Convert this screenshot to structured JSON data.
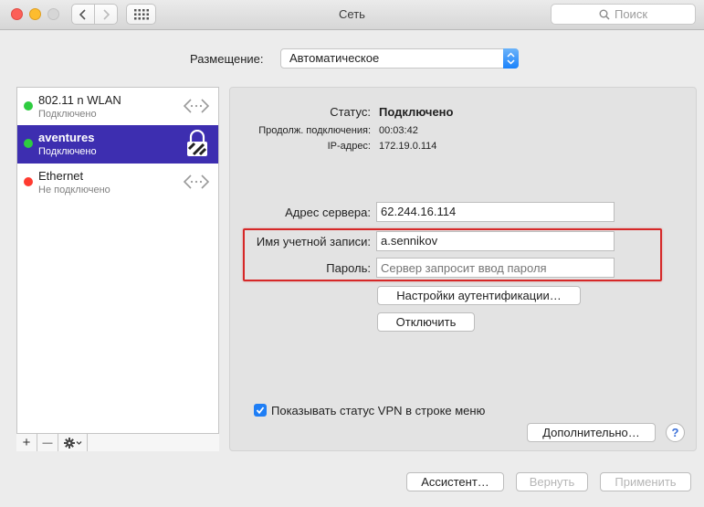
{
  "window": {
    "title": "Сеть",
    "search_placeholder": "Поиск"
  },
  "location": {
    "label": "Размещение:",
    "value": "Автоматическое"
  },
  "services": [
    {
      "name": "802.11 n WLAN",
      "status": "Подключено",
      "status_color": "#2ecc40",
      "icon": "network-arrows-icon"
    },
    {
      "name": "aventures",
      "status": "Подключено",
      "status_color": "#2ecc40",
      "icon": "vpn-lock-icon",
      "selected": true
    },
    {
      "name": "Ethernet",
      "status": "Не подключено",
      "status_color": "#ff3b30",
      "icon": "network-arrows-icon"
    }
  ],
  "sidebar_buttons": {
    "add": "+",
    "remove": "—",
    "action": "gear-icon"
  },
  "details": {
    "status_label": "Статус:",
    "status_value": "Подключено",
    "duration_label": "Продолж. подключения:",
    "duration_value": "00:03:42",
    "ip_label": "IP-адрес:",
    "ip_value": "172.19.0.114"
  },
  "form": {
    "server_label": "Адрес сервера:",
    "server_value": "62.244.16.114",
    "account_label": "Имя учетной записи:",
    "account_value": "a.sennikov",
    "password_label": "Пароль:",
    "password_placeholder": "Сервер запросит ввод пароля",
    "auth_button": "Настройки аутентификации…",
    "disconnect_button": "Отключить"
  },
  "show_vpn_status": {
    "label": "Показывать статус VPN в строке меню",
    "checked": true
  },
  "advanced_button": "Дополнительно…",
  "help_button": "?",
  "footer": {
    "assistant": "Ассистент…",
    "revert": "Вернуть",
    "apply": "Применить"
  },
  "colors": {
    "accent": "#1f7ef5",
    "selection": "#3d2eb0",
    "highlight_box": "#d62828"
  }
}
